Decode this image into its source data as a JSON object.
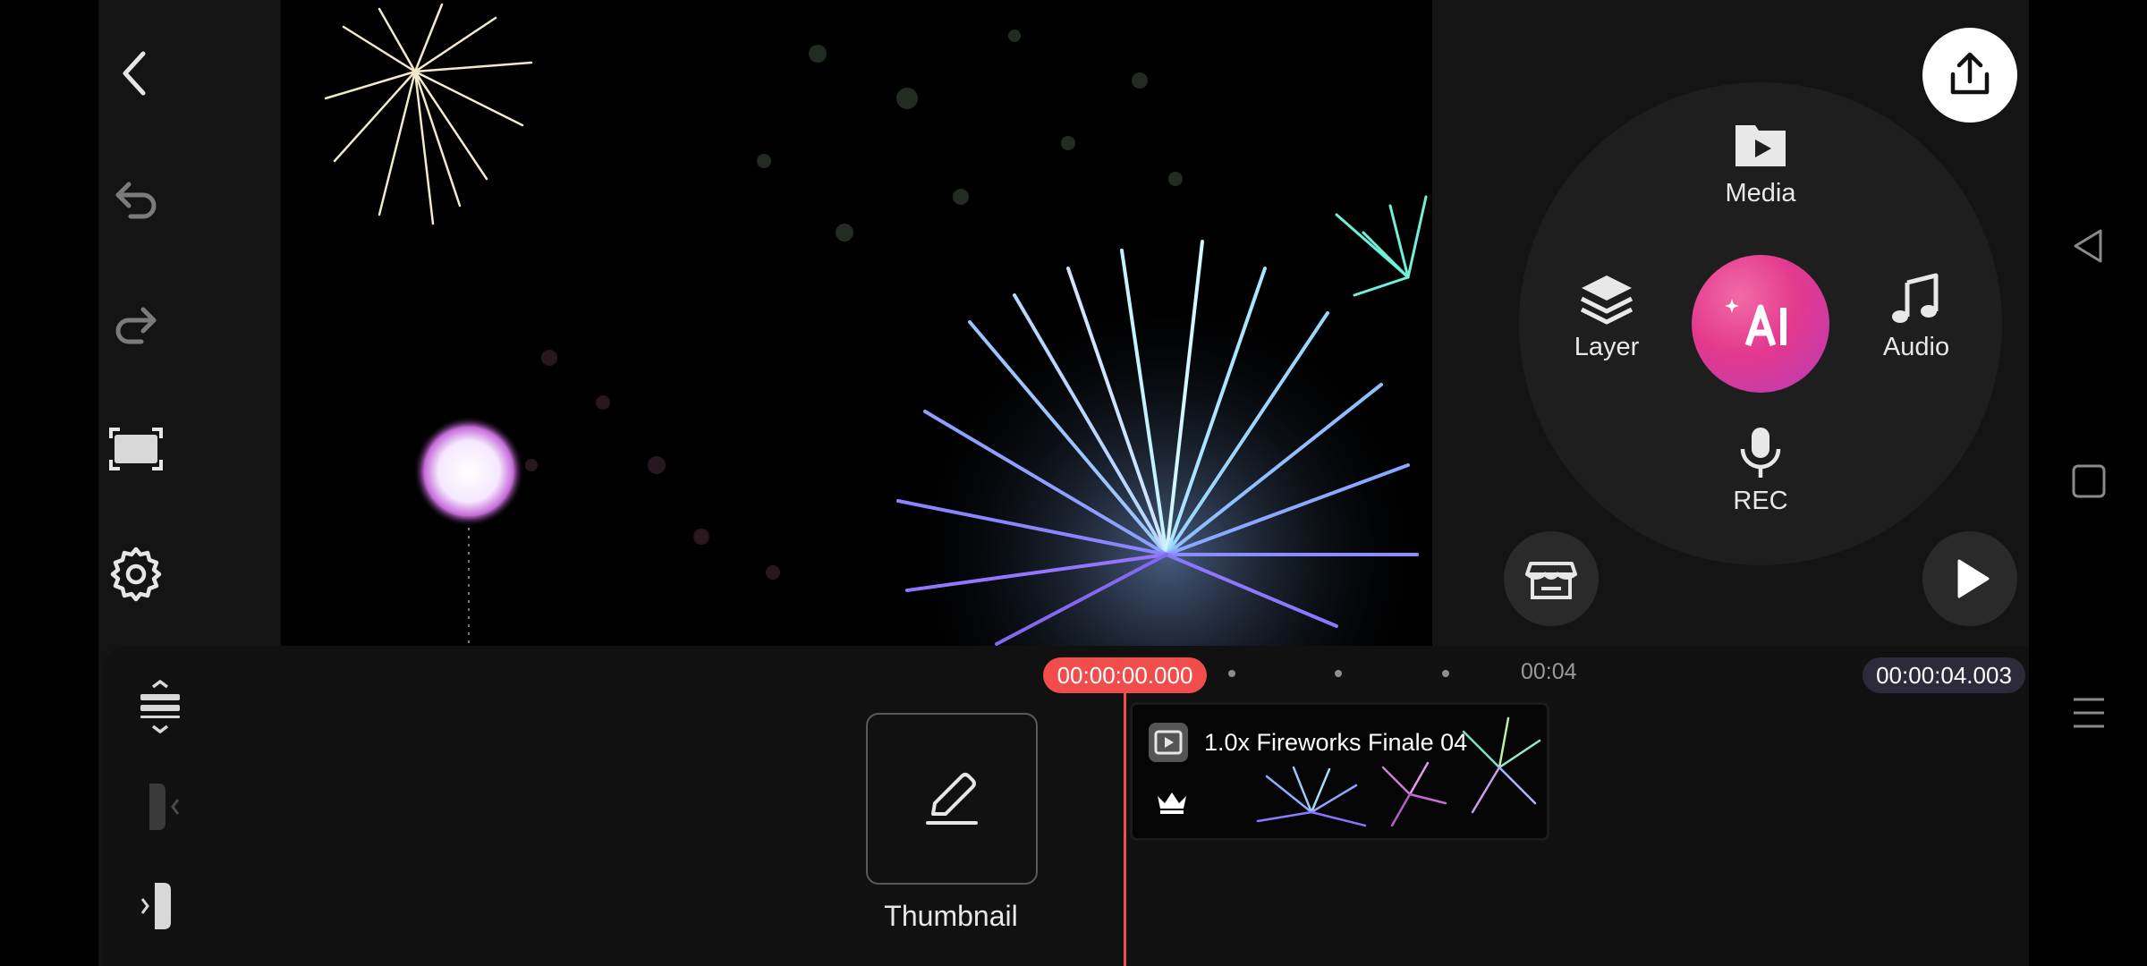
{
  "left_rail": {
    "items": [
      "back",
      "undo",
      "redo",
      "fullscreen",
      "settings"
    ]
  },
  "radial_menu": {
    "media_label": "Media",
    "layer_label": "Layer",
    "audio_label": "Audio",
    "rec_label": "REC",
    "ai_label": "AI"
  },
  "timeline": {
    "current_time": "00:00:00.000",
    "ruler_mark": "00:04",
    "total_duration": "00:00:04.003",
    "thumbnail_label": "Thumbnail",
    "clip_label": "1.0x Fireworks Finale 04"
  },
  "colors": {
    "accent_red": "#f14d4d",
    "ai_gradient_start": "#f26aa6",
    "ai_gradient_end": "#b83db8",
    "background": "#141414"
  }
}
